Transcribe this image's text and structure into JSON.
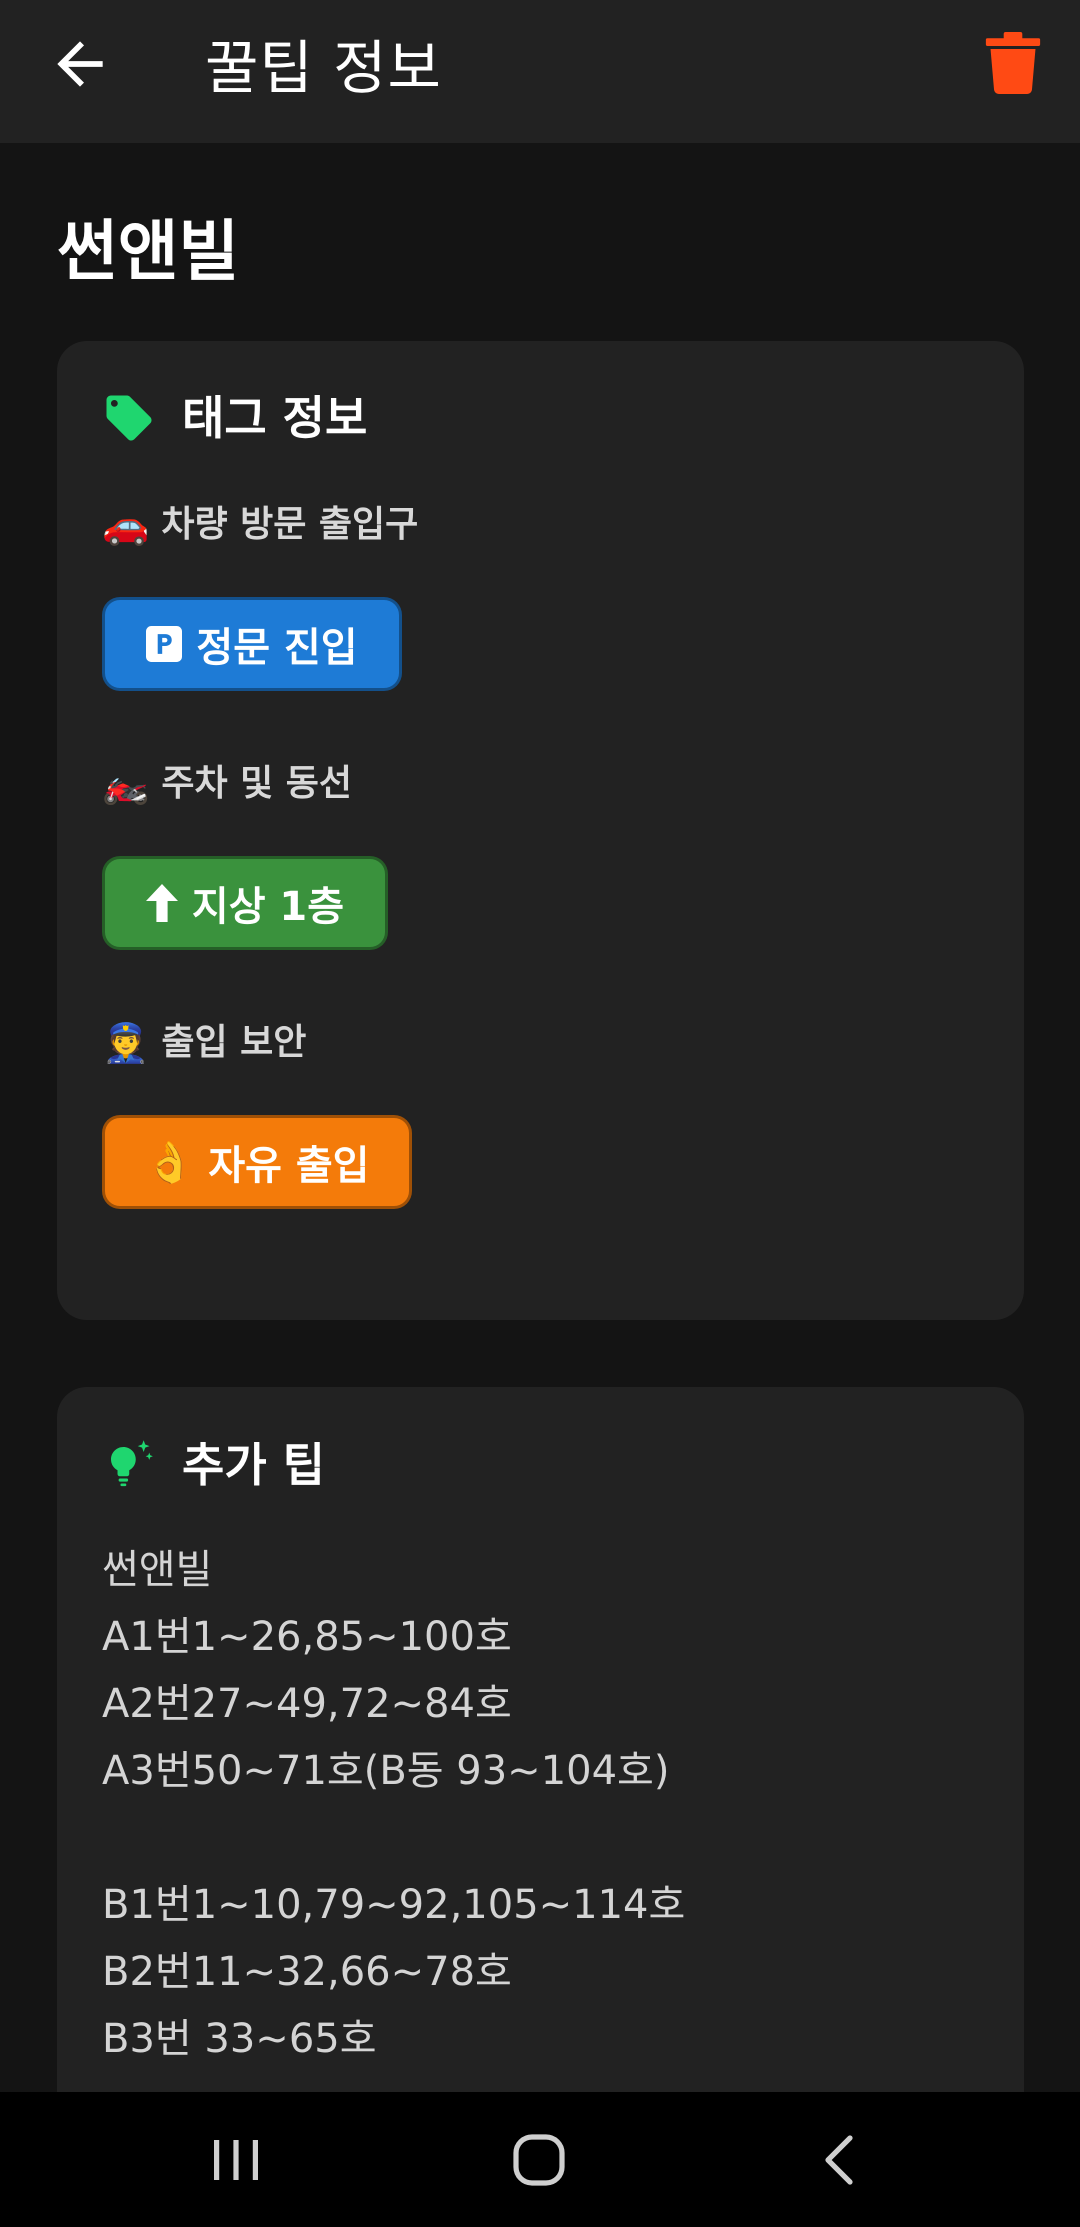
{
  "appbar": {
    "title": "꿀팁 정보",
    "back_icon": "arrow-back-icon",
    "delete_icon": "trash-icon",
    "delete_color": "#ff4a14"
  },
  "page": {
    "title": "썬앤빌"
  },
  "tag_card": {
    "header": "태그 정보",
    "header_icon": "tag-icon",
    "header_icon_color": "#1fd66f",
    "sections": [
      {
        "emoji": "🚗",
        "label": "차량 방문 출입구",
        "chip_icon": "🅿️",
        "chip_label": "정문 진입",
        "chip_color": "#1e7bd6"
      },
      {
        "emoji": "🏍️",
        "label": "주차 및 동선",
        "chip_icon": "⬆️",
        "chip_label": "지상 1층",
        "chip_color": "#3a923d"
      },
      {
        "emoji": "👮",
        "label": "출입 보안",
        "chip_icon": "👌",
        "chip_label": "자유 출입",
        "chip_color": "#f47b0a"
      }
    ]
  },
  "tips_card": {
    "header": "추가 팁",
    "header_icon": "lightbulb-sparkle-icon",
    "header_icon_color": "#1fd66f",
    "body": "썬앤빌\nA1번1~26,85~100호\nA2번27~49,72~84호\nA3번50~71호(B동 93~104호)\n\nB1번1~10,79~92,105~114호\nB2번11~32,66~78호\nB3번 33~65호"
  },
  "navbar": {
    "recents_icon": "recents-icon",
    "home_icon": "home-icon",
    "back_icon": "nav-back-icon"
  }
}
